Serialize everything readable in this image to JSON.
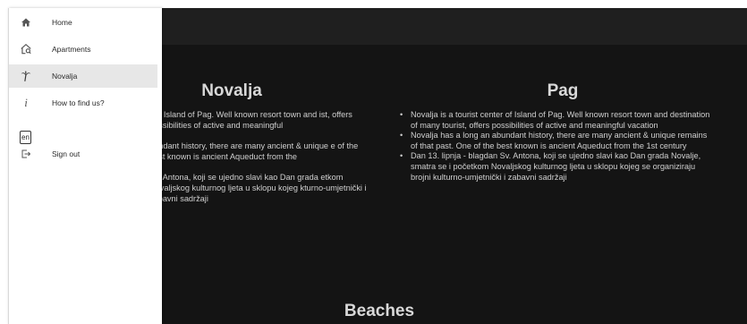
{
  "main": {
    "columns": [
      {
        "title": "Novalja",
        "bullets": [
          "r of Island of Pag. Well known resort town and ist, offers possibilities of active and meaningful",
          "bundant history, there are many ancient & unique e of the best known is ancient Aqueduct from the",
          "Sv. Antona, koji se ujedno slavi kao Dan grada etkom Novaljskog kulturnog ljeta u sklopu kojeg kturno-umjetnički i zabavni sadržaji"
        ]
      },
      {
        "title": "Pag",
        "bullets": [
          "Novalja is a tourist center of Island of Pag. Well known resort town and destination of many tourist, offers possibilities of active and meaningful vacation",
          "Novalja has a long an abundant history, there are many ancient & unique remains of that past. One of the best known is ancient Aqueduct from the 1st century",
          "Dan 13. lipnja - blagdan Sv. Antona, koji se ujedno slavi kao Dan grada Novalje, smatra se i početkom Novaljskog kulturnog ljeta u sklopu kojeg se organiziraju brojni kulturno-umjetnički i zabavni sadržaji"
        ]
      }
    ],
    "section_title": "Beaches"
  },
  "drawer": {
    "items": [
      {
        "label": "Home",
        "icon": "home-icon"
      },
      {
        "label": "Apartments",
        "icon": "apartment-search-icon"
      },
      {
        "label": "Novalja",
        "icon": "palm-tree-icon",
        "selected": true
      },
      {
        "label": "How to find us?",
        "icon": "info-icon"
      },
      {
        "label": "en",
        "icon": "language-icon"
      },
      {
        "label": "Sign out",
        "icon": "sign-out-icon"
      }
    ]
  },
  "colors": {
    "page_bg": "#141414",
    "topbar_bg": "#1f1f1f",
    "drawer_bg": "#ffffff",
    "selected_bg": "#e7e7e7"
  }
}
